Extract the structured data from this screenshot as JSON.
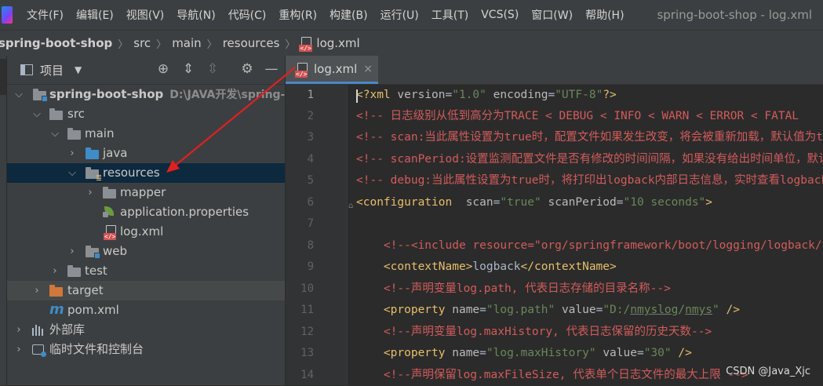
{
  "menubar": {
    "items": [
      "文件(F)",
      "编辑(E)",
      "视图(V)",
      "导航(N)",
      "代码(C)",
      "重构(R)",
      "构建(B)",
      "运行(U)",
      "工具(T)",
      "VCS(S)",
      "窗口(W)",
      "帮助(H)"
    ],
    "window_title": "spring-boot-shop - log.xml"
  },
  "breadcrumb": [
    "spring-boot-shop",
    "src",
    "main",
    "resources",
    "log.xml"
  ],
  "project_panel": {
    "title": "项目",
    "dropdown": "▼",
    "tree": [
      {
        "label": "spring-boot-shop",
        "path": "D:\\JAVA开发\\spring-bo",
        "icon": "module-folder-icon",
        "expanded": true,
        "bold": true
      },
      {
        "label": "src",
        "icon": "folder-icon",
        "expanded": true
      },
      {
        "label": "main",
        "icon": "folder-icon",
        "expanded": true
      },
      {
        "label": "java",
        "icon": "source-folder-icon",
        "expanded": false
      },
      {
        "label": "resources",
        "icon": "resources-folder-icon",
        "expanded": true,
        "selected": true
      },
      {
        "label": "mapper",
        "icon": "folder-icon",
        "expanded": false
      },
      {
        "label": "application.properties",
        "icon": "spring-properties-icon"
      },
      {
        "label": "log.xml",
        "icon": "xml-file-icon"
      },
      {
        "label": "web",
        "icon": "module-folder-icon",
        "expanded": false
      },
      {
        "label": "test",
        "icon": "folder-icon",
        "expanded": false
      },
      {
        "label": "target",
        "icon": "excluded-folder-icon",
        "expanded": false
      },
      {
        "label": "pom.xml",
        "icon": "maven-icon"
      },
      {
        "label": "外部库",
        "icon": "libraries-icon",
        "expanded": false
      },
      {
        "label": "临时文件和控制台",
        "icon": "scratches-icon",
        "expanded": false
      }
    ]
  },
  "editor": {
    "tab_label": "log.xml",
    "tab_close": "×",
    "line_numbers": [
      "1",
      "2",
      "3",
      "4",
      "5",
      "6",
      "7",
      "8",
      "9",
      "10",
      "11",
      "12",
      "13",
      "14"
    ],
    "lines": [
      "<?xml version=\"1.0\" encoding=\"UTF-8\"?>",
      "<!-- 日志级别从低到高分为TRACE < DEBUG < INFO < WARN < ERROR < FATAL",
      "<!-- scan:当此属性设置为true时，配置文件如果发生改变，将会被重新加载，默认值为true -->",
      "<!-- scanPeriod:设置监测配置文件是否有修改的时间间隔，如果没有给出时间单位，默认单位是毫秒",
      "<!-- debug:当此属性设置为true时，将打印出logback内部日志信息，实时查看logback运行状态",
      "<configuration  scan=\"true\" scanPeriod=\"10 seconds\">",
      "",
      "    <!--<include resource=\"org/springframework/boot/logging/logback/base.xml\" />-->",
      "    <contextName>logback</contextName>",
      "    <!--声明变量log.path, 代表日志存储的目录名称-->",
      "    <property name=\"log.path\" value=\"D:/nmyslog/nmys\" />",
      "    <!--声明变量log.maxHistory, 代表日志保留的历史天数-->",
      "    <property name=\"log.maxHistory\" value=\"30\" />",
      "    <!--声明保留log.maxFileSize, 代表单个日志文件的最大上限 -->"
    ],
    "segments": {
      "l1": [
        "<?xml ",
        "version",
        "=",
        "\"1.0\"",
        " ",
        "encoding",
        "=",
        "\"UTF-8\"",
        "?>"
      ],
      "l6": [
        "<configuration",
        "  ",
        "scan",
        "=",
        "\"true\"",
        " ",
        "scanPeriod",
        "=",
        "\"10 seconds\"",
        ">"
      ],
      "l9": [
        "    ",
        "<contextName>",
        "logback",
        "</contextName>"
      ],
      "l11": [
        "    ",
        "<property ",
        "name",
        "=",
        "\"log.path\"",
        " ",
        "value",
        "=",
        "\"D:/",
        "nmyslog",
        "/",
        "nmys",
        "\"",
        " />"
      ],
      "l13": [
        "    ",
        "<property ",
        "name",
        "=",
        "\"log.maxHistory\"",
        " ",
        "value",
        "=",
        "\"30\"",
        " />"
      ]
    }
  },
  "watermark": "CSDN @Java_Xjc",
  "colors": {
    "background": "#2b2b2b",
    "panel": "#3c3f41",
    "selection": "#0d293e",
    "tag": "#e8bf6a",
    "string": "#6a8759",
    "comment": "#d35b5b",
    "annotation_arrow": "#e02020"
  }
}
